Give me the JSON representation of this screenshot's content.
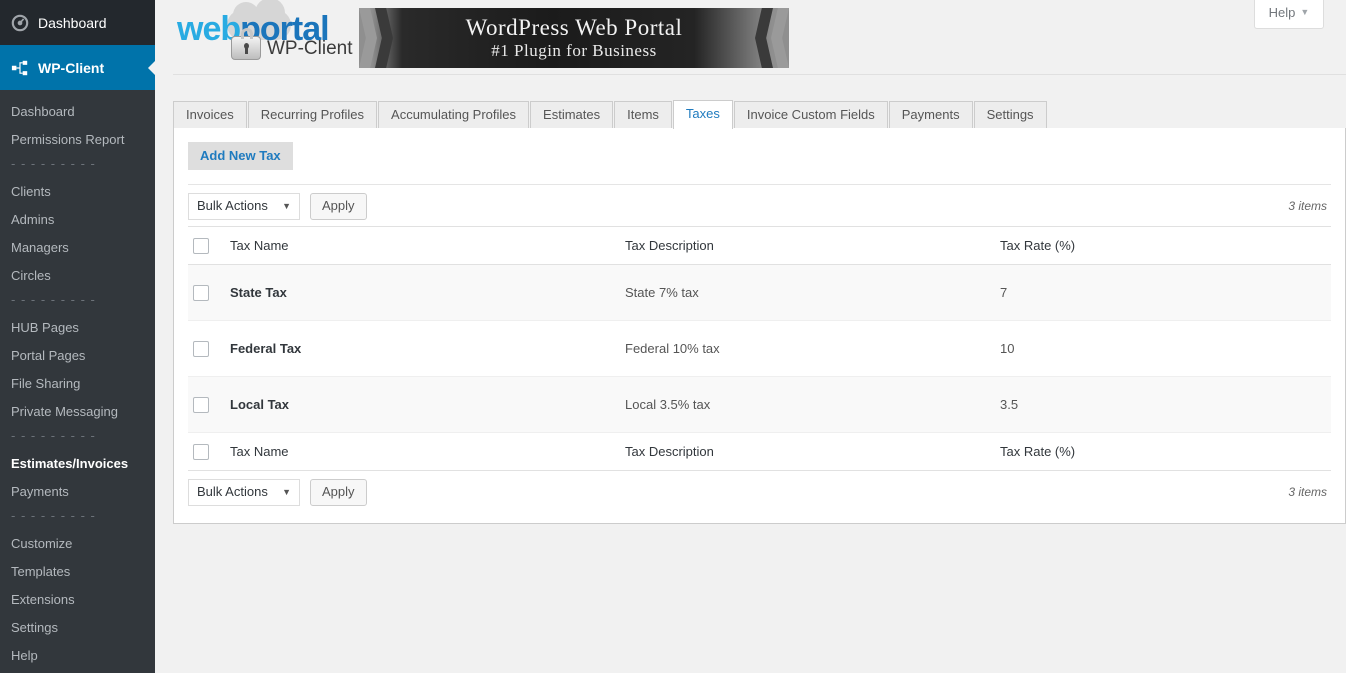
{
  "sidebar": {
    "top_item": {
      "label": "Dashboard",
      "icon": "dashboard-gauge-icon"
    },
    "active_item": {
      "label": "WP-Client",
      "icon": "sitemap-icon"
    },
    "separator": "- - - - - - - - -",
    "items": [
      {
        "label": "Dashboard",
        "type": "link",
        "current": false
      },
      {
        "label": "Permissions Report",
        "type": "link",
        "current": false
      },
      {
        "label": "- - - - - - - - -",
        "type": "separator",
        "current": false
      },
      {
        "label": "Clients",
        "type": "link",
        "current": false
      },
      {
        "label": "Admins",
        "type": "link",
        "current": false
      },
      {
        "label": "Managers",
        "type": "link",
        "current": false
      },
      {
        "label": "Circles",
        "type": "link",
        "current": false
      },
      {
        "label": "- - - - - - - - -",
        "type": "separator",
        "current": false
      },
      {
        "label": "HUB Pages",
        "type": "link",
        "current": false
      },
      {
        "label": "Portal Pages",
        "type": "link",
        "current": false
      },
      {
        "label": "File Sharing",
        "type": "link",
        "current": false
      },
      {
        "label": "Private Messaging",
        "type": "link",
        "current": false
      },
      {
        "label": "- - - - - - - - -",
        "type": "separator",
        "current": false
      },
      {
        "label": "Estimates/Invoices",
        "type": "link",
        "current": true
      },
      {
        "label": "Payments",
        "type": "link",
        "current": false
      },
      {
        "label": "- - - - - - - - -",
        "type": "separator",
        "current": false
      },
      {
        "label": "Customize",
        "type": "link",
        "current": false
      },
      {
        "label": "Templates",
        "type": "link",
        "current": false
      },
      {
        "label": "Extensions",
        "type": "link",
        "current": false
      },
      {
        "label": "Settings",
        "type": "link",
        "current": false
      },
      {
        "label": "Help",
        "type": "link",
        "current": false
      }
    ]
  },
  "header": {
    "help_label": "Help",
    "help_caret": "▼",
    "logo": {
      "word_part1": "web",
      "word_part2": "portal",
      "subtitle": "WP-Client"
    },
    "banner": {
      "line1": "WordPress Web Portal",
      "line2": "#1 Plugin for Business"
    }
  },
  "tabs": [
    {
      "label": "Invoices",
      "active": false
    },
    {
      "label": "Recurring Profiles",
      "active": false
    },
    {
      "label": "Accumulating Profiles",
      "active": false
    },
    {
      "label": "Estimates",
      "active": false
    },
    {
      "label": "Items",
      "active": false
    },
    {
      "label": "Taxes",
      "active": true
    },
    {
      "label": "Invoice Custom Fields",
      "active": false
    },
    {
      "label": "Payments",
      "active": false
    },
    {
      "label": "Settings",
      "active": false
    }
  ],
  "toolbar": {
    "add_new_label": "Add New Tax",
    "bulk_actions_label": "Bulk Actions",
    "bulk_caret": "▼",
    "apply_label": "Apply",
    "items_count_top": "3 items",
    "items_count_bottom": "3 items"
  },
  "table": {
    "columns": [
      "Tax Name",
      "Tax Description",
      "Tax Rate (%)"
    ],
    "rows": [
      {
        "name": "State Tax",
        "description": "State 7% tax",
        "rate": "7"
      },
      {
        "name": "Federal Tax",
        "description": "Federal 10% tax",
        "rate": "10"
      },
      {
        "name": "Local Tax",
        "description": "Local 3.5% tax",
        "rate": "3.5"
      }
    ]
  },
  "colors": {
    "sidebar_bg": "#32373c",
    "sidebar_top_bg": "#23282d",
    "accent_blue": "#0073aa",
    "tab_active_text": "#1f7bbf",
    "page_bg": "#f1f1f1",
    "logo_web": "#29abe2",
    "logo_portal": "#1b75bb"
  }
}
